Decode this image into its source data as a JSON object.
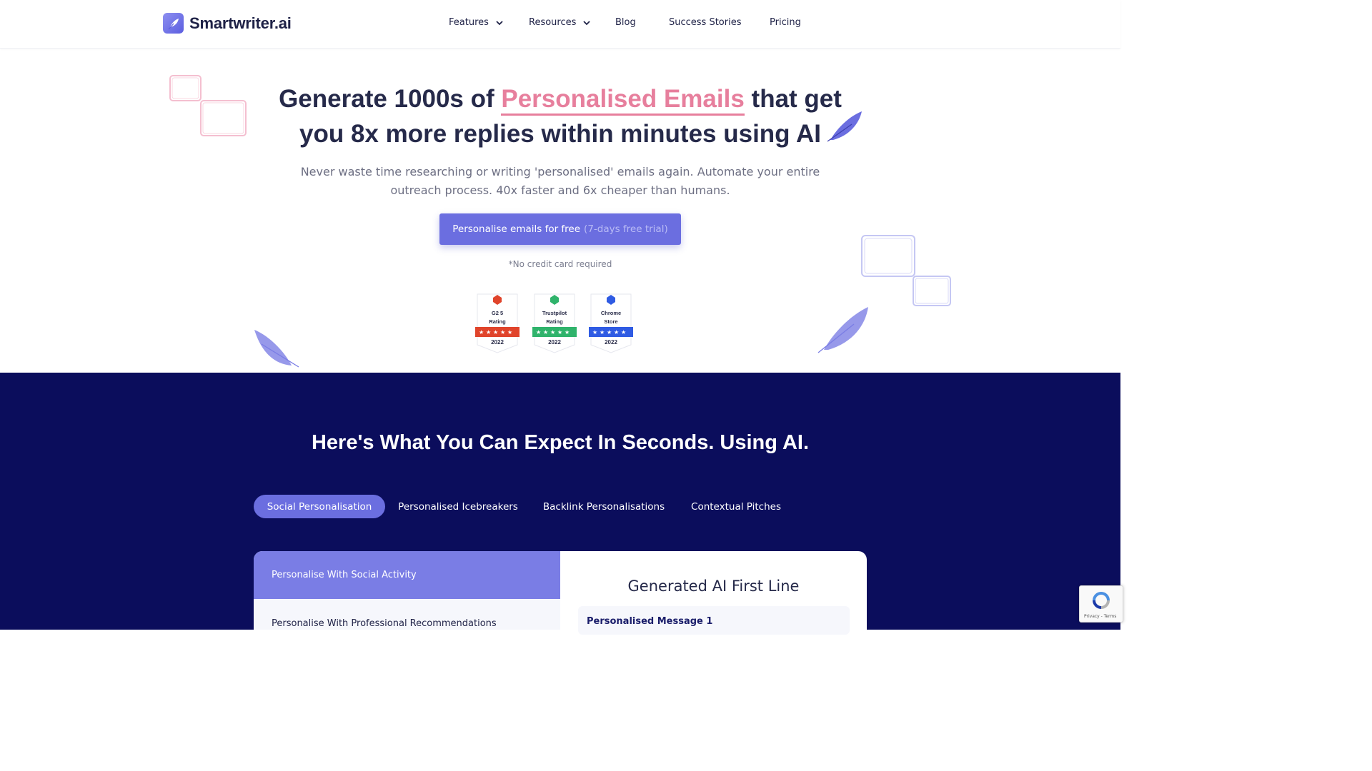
{
  "nav": {
    "brand": "Smartwriter.ai",
    "items": [
      {
        "label": "Features",
        "dropdown": true
      },
      {
        "label": "Resources",
        "dropdown": true
      },
      {
        "label": "Blog"
      },
      {
        "label": "Success Stories"
      },
      {
        "label": "Pricing"
      }
    ]
  },
  "hero": {
    "title_pre": "Generate 1000s of ",
    "title_highlight": "Personalised Emails",
    "title_post": " that get you 8x more replies within minutes using AI",
    "subtitle": "Never waste time researching or writing 'personalised' emails again. Automate your entire outreach process. 40x faster and 6x cheaper than humans.",
    "cta_main": "Personalise emails for free",
    "cta_muted": "(7-days free trial)",
    "note": "*No credit card required",
    "badges": [
      {
        "line1": "G2 5",
        "line2": "Rating",
        "year": "2022",
        "color": "#e0442b"
      },
      {
        "line1": "Trustpilot",
        "line2": "Rating",
        "year": "2022",
        "color": "#2fb36b"
      },
      {
        "line1": "Chrome",
        "line2": "Store",
        "year": "2022",
        "color": "#2f5be3"
      }
    ]
  },
  "features": {
    "title": "Here's What You Can Expect In Seconds. Using AI.",
    "tabs": [
      "Social Personalisation",
      "Personalised Icebreakers",
      "Backlink Personalisations",
      "Contextual Pitches"
    ],
    "left_items": [
      "Personalise With Social Activity",
      "Personalise With Professional Recommendations"
    ],
    "right_title": "Generated AI First Line",
    "message_label": "Personalised Message 1"
  },
  "recaptcha": {
    "text": "Privacy - Terms"
  },
  "colors": {
    "accent": "#6b6ee0",
    "highlight": "#e77f9d",
    "dark_bg": "#0b0d5c"
  }
}
